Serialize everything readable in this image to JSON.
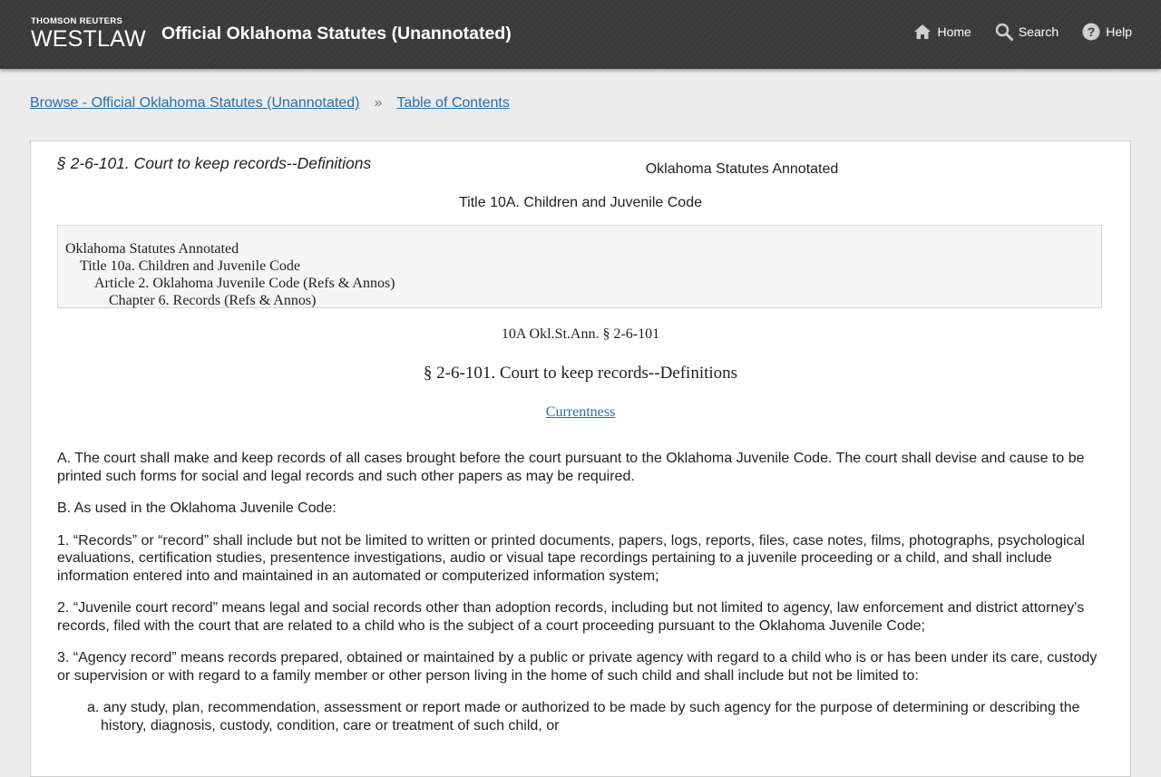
{
  "header": {
    "brand": "THOMSON REUTERS",
    "product": "WESTLAW",
    "title": "Official Oklahoma Statutes (Unannotated)",
    "nav": {
      "home": "Home",
      "search": "Search",
      "help": "Help"
    }
  },
  "breadcrumb": {
    "browse": "Browse - Official Oklahoma Statutes (Unannotated)",
    "separator": "»",
    "toc": "Table of Contents"
  },
  "document": {
    "head_title": "§ 2-6-101. Court to keep records--Definitions",
    "source": "Oklahoma Statutes Annotated",
    "title_line": "Title 10A. Children and Juvenile Code",
    "toc": [
      "Oklahoma Statutes Annotated",
      "Title 10a. Children and Juvenile Code",
      "Article 2. Oklahoma Juvenile Code (Refs & Annos)",
      "Chapter 6. Records (Refs & Annos)"
    ],
    "citation": "10A Okl.St.Ann. § 2-6-101",
    "section_heading": "§ 2-6-101. Court to keep records--Definitions",
    "currentness": "Currentness",
    "paragraphs": {
      "a": "A. The court shall make and keep records of all cases brought before the court pursuant to the Oklahoma Juvenile Code. The court shall devise and cause to be printed such forms for social and legal records and such other papers as may be required.",
      "b": "B. As used in the Oklahoma Juvenile Code:",
      "p1": "1. “Records” or “record” shall include but not be limited to written or printed documents, papers, logs, reports, files, case notes, films, photographs, psychological evaluations, certification studies, presentence investigations, audio or visual tape recordings pertaining to a juvenile proceeding or a child, and shall include information entered into and maintained in an automated or computerized information system;",
      "p2": "2. “Juvenile court record” means legal and social records other than adoption records, including but not limited to agency, law enforcement and district attorney's records, filed with the court that are related to a child who is the subject of a court proceeding pursuant to the Oklahoma Juvenile Code;",
      "p3": "3. “Agency record” means records prepared, obtained or maintained by a public or private agency with regard to a child who is or has been under its care, custody or supervision or with regard to a family member or other person living in the home of such child and shall include but not be limited to:",
      "p3a": "a. any study, plan, recommendation, assessment or report made or authorized to be made by such agency for the purpose of determining or describing the history, diagnosis, custody, condition, care or treatment of such child, or"
    }
  },
  "icons": {
    "home": "home-icon",
    "search": "search-icon",
    "help": "help-icon"
  },
  "colors": {
    "header_bg": "#3a3a3a",
    "link": "#2c6ea4",
    "page_bg": "#ececec"
  }
}
